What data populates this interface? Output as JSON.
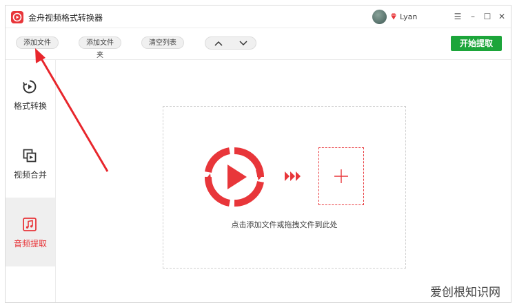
{
  "app": {
    "title": "金舟视频格式转换器"
  },
  "user": {
    "name": "Lyan"
  },
  "window_controls": {
    "menu": "☰",
    "minimize": "–",
    "maximize": "☐",
    "close": "✕"
  },
  "toolbar": {
    "add_file": "添加文件",
    "add_folder": "添加文件夹",
    "clear_list": "清空列表",
    "start": "开始提取"
  },
  "sidebar": {
    "items": [
      {
        "label": "格式转换",
        "icon": "play-circle-icon",
        "active": false
      },
      {
        "label": "视频合并",
        "icon": "merge-icon",
        "active": false
      },
      {
        "label": "音频提取",
        "icon": "music-icon",
        "active": true
      }
    ]
  },
  "main": {
    "hint": "点击添加文件或拖拽文件到此处"
  },
  "watermark": "爱创根知识网",
  "colors": {
    "brand": "#e8363a",
    "start": "#1ca53a",
    "annotation": "#e8262c"
  }
}
